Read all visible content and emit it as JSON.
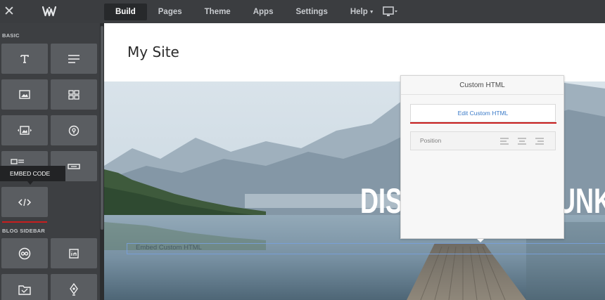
{
  "topbar": {
    "nav": [
      {
        "label": "Build",
        "active": true
      },
      {
        "label": "Pages",
        "active": false
      },
      {
        "label": "Theme",
        "active": false
      },
      {
        "label": "Apps",
        "active": false
      },
      {
        "label": "Settings",
        "active": false
      },
      {
        "label": "Help",
        "active": false
      }
    ]
  },
  "sidebar": {
    "basic_label": "BASIC",
    "blog_sidebar_label": "BLOG SIDEBAR",
    "tooltip": "EMBED CODE",
    "basic_tiles": [
      {
        "icon": "title-icon"
      },
      {
        "icon": "text-icon"
      },
      {
        "icon": "image-icon"
      },
      {
        "icon": "gallery-icon"
      },
      {
        "icon": "slideshow-icon"
      },
      {
        "icon": "map-icon"
      },
      {
        "icon": "contact-form-icon"
      },
      {
        "icon": "button-icon"
      },
      {
        "icon": "embed-code-icon"
      }
    ],
    "blog_tiles": [
      {
        "icon": "social-icon"
      },
      {
        "icon": "linkedin-icon"
      },
      {
        "icon": "archives-icon"
      },
      {
        "icon": "feed-icon"
      }
    ]
  },
  "canvas": {
    "site_title": "My Site",
    "headline": "DISCOVER THE UNKNOWN SIDE",
    "button_text": "Embed Custom HTML"
  },
  "panel": {
    "title": "Custom HTML",
    "edit_button": "Edit Custom HTML",
    "position_label": "Position"
  },
  "colors": {
    "topbar_bg": "#3b3d40",
    "sidebar_bg": "#3d3f42",
    "tile_bg": "#5a5d61",
    "accent_red": "#c81e1e",
    "link_blue": "#3a7ac8"
  }
}
